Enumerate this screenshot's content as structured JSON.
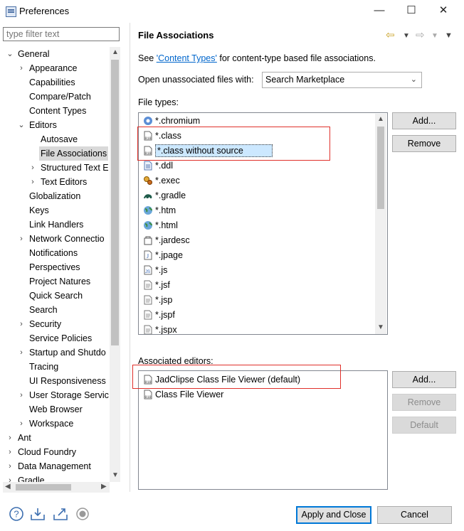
{
  "window": {
    "title": "Preferences",
    "minimize": "—",
    "maximize": "☐",
    "close": "✕"
  },
  "filter": {
    "placeholder": "type filter text"
  },
  "tree": {
    "items": [
      {
        "label": "General",
        "expanded": true
      },
      {
        "label": "Appearance"
      },
      {
        "label": "Capabilities"
      },
      {
        "label": "Compare/Patch"
      },
      {
        "label": "Content Types"
      },
      {
        "label": "Editors",
        "expanded": true
      },
      {
        "label": "Autosave"
      },
      {
        "label": "File Associations",
        "selected": true
      },
      {
        "label": "Structured Text E"
      },
      {
        "label": "Text Editors"
      },
      {
        "label": "Globalization"
      },
      {
        "label": "Keys"
      },
      {
        "label": "Link Handlers"
      },
      {
        "label": "Network Connectio"
      },
      {
        "label": "Notifications"
      },
      {
        "label": "Perspectives"
      },
      {
        "label": "Project Natures"
      },
      {
        "label": "Quick Search"
      },
      {
        "label": "Search"
      },
      {
        "label": "Security"
      },
      {
        "label": "Service Policies"
      },
      {
        "label": "Startup and Shutdo"
      },
      {
        "label": "Tracing"
      },
      {
        "label": "UI Responsiveness"
      },
      {
        "label": "User Storage Servic"
      },
      {
        "label": "Web Browser"
      },
      {
        "label": "Workspace"
      },
      {
        "label": "Ant"
      },
      {
        "label": "Cloud Foundry"
      },
      {
        "label": "Data Management"
      },
      {
        "label": "Gradle"
      }
    ]
  },
  "page": {
    "title": "File Associations",
    "see_prefix": "See ",
    "see_link": "'Content Types'",
    "see_suffix": " for content-type based file associations.",
    "open_unassoc_label": "Open unassociated files with:",
    "open_unassoc_value": "Search Marketplace",
    "file_types_label": "File types:",
    "associated_editors_label": "Associated editors:"
  },
  "file_types": [
    {
      "label": "*.chromium",
      "icon": "chromium-icon"
    },
    {
      "label": "*.class",
      "icon": "class-file-icon"
    },
    {
      "label": "*.class without source",
      "icon": "class-file-icon",
      "selected": true
    },
    {
      "label": "*.ddl",
      "icon": "ddl-file-icon"
    },
    {
      "label": "*.exec",
      "icon": "exec-gear-icon"
    },
    {
      "label": "*.gradle",
      "icon": "gradle-elephant-icon"
    },
    {
      "label": "*.htm",
      "icon": "globe-icon"
    },
    {
      "label": "*.html",
      "icon": "globe-icon"
    },
    {
      "label": "*.jardesc",
      "icon": "jar-icon"
    },
    {
      "label": "*.jpage",
      "icon": "jpage-icon"
    },
    {
      "label": "*.js",
      "icon": "js-file-icon"
    },
    {
      "label": "*.jsf",
      "icon": "text-file-icon"
    },
    {
      "label": "*.jsp",
      "icon": "text-file-icon"
    },
    {
      "label": "*.jspf",
      "icon": "text-file-icon"
    },
    {
      "label": "*.jspx",
      "icon": "text-file-icon"
    }
  ],
  "editors": [
    {
      "label": "JadClipse Class File Viewer (default)",
      "icon": "class-file-icon"
    },
    {
      "label": "Class File Viewer",
      "icon": "class-file-icon"
    }
  ],
  "buttons": {
    "ft_add": "Add...",
    "ft_remove": "Remove",
    "ed_add": "Add...",
    "ed_remove": "Remove",
    "ed_default": "Default",
    "apply_close": "Apply and Close",
    "cancel": "Cancel"
  },
  "colors": {
    "accent": "#0078d7",
    "highlight_box": "#e0302a",
    "link": "#0066cc"
  }
}
